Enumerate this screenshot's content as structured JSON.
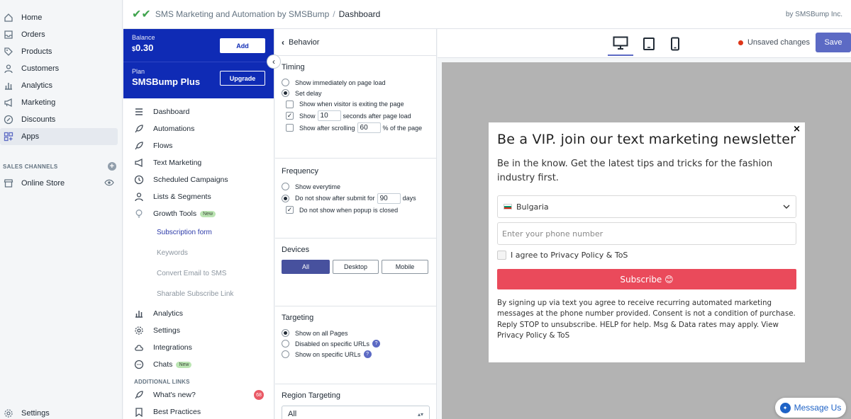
{
  "admin_nav": {
    "items": [
      {
        "label": "Home",
        "icon": "home-icon"
      },
      {
        "label": "Orders",
        "icon": "orders-icon"
      },
      {
        "label": "Products",
        "icon": "tag-icon"
      },
      {
        "label": "Customers",
        "icon": "person-icon"
      },
      {
        "label": "Analytics",
        "icon": "bar-chart-icon"
      },
      {
        "label": "Marketing",
        "icon": "megaphone-icon"
      },
      {
        "label": "Discounts",
        "icon": "discount-icon"
      },
      {
        "label": "Apps",
        "icon": "apps-icon"
      }
    ],
    "sales_channels_label": "SALES CHANNELS",
    "online_store": "Online Store",
    "settings": "Settings"
  },
  "header": {
    "app_name": "SMS Marketing and Automation by SMSBump",
    "separator": "/",
    "page": "Dashboard",
    "by": "by SMSBump Inc."
  },
  "account": {
    "balance_label": "Balance",
    "currency": "$",
    "balance_value": "0.30",
    "add_label": "Add",
    "plan_label": "Plan",
    "plan_value": "SMSBump Plus",
    "upgrade_label": "Upgrade"
  },
  "app_nav": {
    "items": [
      "Dashboard",
      "Automations",
      "Flows",
      "Text Marketing",
      "Scheduled Campaigns",
      "Lists & Segments",
      "Growth Tools"
    ],
    "growth_badge": "New",
    "sub_items": [
      "Subscription form",
      "Keywords",
      "Convert Email to SMS",
      "Sharable Subscribe Link"
    ],
    "items2": [
      "Analytics",
      "Settings",
      "Integrations",
      "Chats"
    ],
    "chats_badge": "New",
    "additional_label": "ADDITIONAL LINKS",
    "whats_new": "What's new?",
    "whats_new_count": "68",
    "best_practices": "Best Practices"
  },
  "panel": {
    "title": "Behavior",
    "timing": {
      "heading": "Timing",
      "opt_immediately": "Show immediately on page load",
      "opt_delay": "Set delay",
      "opt_exiting": "Show when visitor is exiting the page",
      "show_label": "Show",
      "show_seconds": "10",
      "seconds_after": "seconds after page load",
      "scroll_label": "Show after scrolling",
      "scroll_value": "60",
      "scroll_after": "% of the page"
    },
    "frequency": {
      "heading": "Frequency",
      "opt_everytime": "Show everytime",
      "opt_not_after": "Do not show after submit for",
      "days_value": "90",
      "days_label": "days",
      "opt_closed": "Do not show when popup is closed"
    },
    "devices": {
      "heading": "Devices",
      "options": [
        "All",
        "Desktop",
        "Mobile"
      ]
    },
    "targeting": {
      "heading": "Targeting",
      "opt_all": "Show on all Pages",
      "opt_disabled": "Disabled on specific URLs",
      "opt_show_specific": "Show on specific URLs",
      "help": "?"
    },
    "region": {
      "heading": "Region Targeting",
      "value": "All"
    }
  },
  "preview": {
    "unsaved": "Unsaved changes",
    "save": "Save"
  },
  "popup": {
    "title": "Be a VIP. join our text marketing newsletter",
    "subtitle": "Be in the know. Get the latest tips and tricks for the fashion industry first.",
    "country": "Bulgaria",
    "phone_placeholder": "Enter your phone number",
    "agree": "I agree to Privacy Policy & ToS",
    "subscribe": "Subscribe 😊",
    "legal": "By signing up via text you agree to receive recurring automated marketing messages at the phone number provided. Consent is not a condition of purchase. Reply STOP to unsubscribe. HELP for help. Msg & Data rates may apply. View Privacy Policy & ToS"
  },
  "chat_widget": {
    "label": "Message Us"
  },
  "colors": {
    "brand_blue": "#0f2bb5",
    "accent": "#5c6ac4",
    "subscribe": "#ea4a5b"
  }
}
